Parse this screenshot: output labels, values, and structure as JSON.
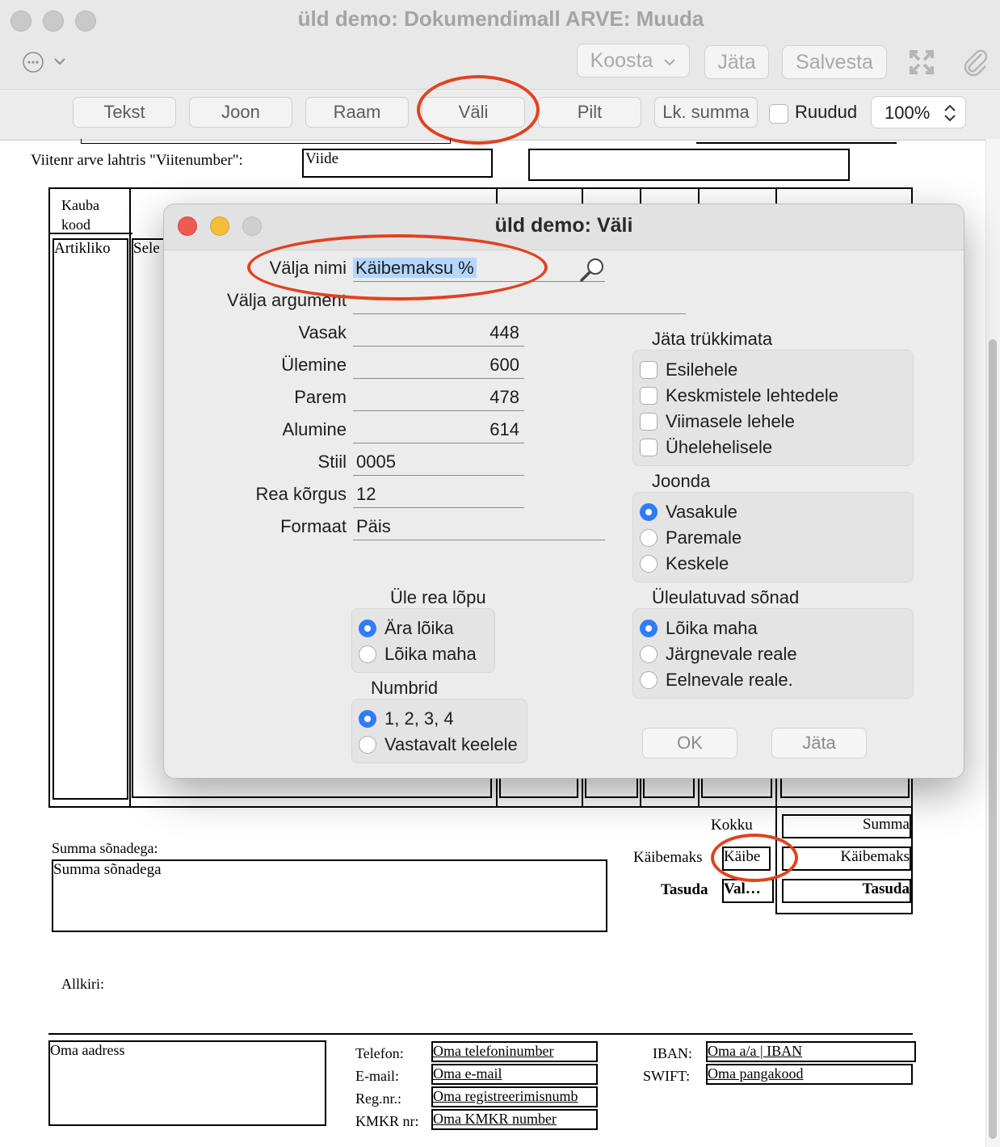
{
  "window": {
    "title": "üld demo: Dokumendimall ARVE: Muuda",
    "buttons": {
      "koosta": "Koosta",
      "jata": "Jäta",
      "salvesta": "Salvesta"
    }
  },
  "toolbar": {
    "tools": [
      "Tekst",
      "Joon",
      "Raam",
      "Väli",
      "Pilt",
      "Lk. summa"
    ],
    "ruudud_label": "Ruudud",
    "zoom": "100%"
  },
  "document": {
    "viitenr_label": "Viitenr arve lahtris \"Viitenumber\":",
    "viide_field": "Viide",
    "kauba_kood": "Kauba\nkood",
    "artikliko": "Artikliko",
    "sele": "Sele",
    "kokku": "Kokku",
    "summa": "Summa",
    "kaibemaks_label": "Käibemaks",
    "kaibe_field": "Käibe",
    "kaibemaks_value": "Käibemaks",
    "tasuda_label": "Tasuda",
    "val_field": "Val…",
    "tasuda_value": "Tasuda",
    "summa_sonadega_label": "Summa sõnadega:",
    "summa_sonadega_field": "Summa sõnadega",
    "allkiri": "Allkiri:",
    "oma_aadress": "Oma aadress",
    "footer_labels": {
      "telefon": "Telefon:",
      "email": "E-mail:",
      "regnr": "Reg.nr.:",
      "kmkr": "KMKR nr:",
      "iban": "IBAN:",
      "swift": "SWIFT:"
    },
    "footer_values": {
      "telefon": "Oma telefoninumber",
      "email": "Oma e-mail",
      "regnr": "Oma registreerimisnumb",
      "kmkr": "Oma KMKR number",
      "iban": "Oma a/a | IBAN",
      "swift": "Oma pangakood"
    }
  },
  "dialog": {
    "title": "üld demo: Väli",
    "fields": {
      "valja_nimi": {
        "label": "Välja nimi",
        "value": "Käibemaksu %"
      },
      "valja_argument": {
        "label": "Välja argument",
        "value": ""
      },
      "vasak": {
        "label": "Vasak",
        "value": "448"
      },
      "ulemine": {
        "label": "Ülemine",
        "value": "600"
      },
      "parem": {
        "label": "Parem",
        "value": "478"
      },
      "alumine": {
        "label": "Alumine",
        "value": "614"
      },
      "stiil": {
        "label": "Stiil",
        "value": "0005"
      },
      "rea_korgus": {
        "label": "Rea kõrgus",
        "value": "12"
      },
      "formaat": {
        "label": "Formaat",
        "value": "Päis"
      }
    },
    "jata_trukkimata": {
      "title": "Jäta trükkimata",
      "options": [
        "Esilehele",
        "Keskmistele lehtedele",
        "Viimasele lehele",
        "Ühelehelisele"
      ]
    },
    "joonda": {
      "title": "Joonda",
      "options": [
        "Vasakule",
        "Paremale",
        "Keskele"
      ],
      "selected": "Vasakule"
    },
    "uleulatuvad": {
      "title": "Üleulatuvad sõnad",
      "options": [
        "Lõika maha",
        "Järgnevale reale",
        "Eelnevale reale."
      ],
      "selected": "Lõika maha"
    },
    "ule_rea_lopu": {
      "title": "Üle rea lõpu",
      "options": [
        "Ära lõika",
        "Lõika maha"
      ],
      "selected": "Ära lõika"
    },
    "numbrid": {
      "title": "Numbrid",
      "options": [
        "1, 2, 3, 4",
        "Vastavalt keelele"
      ],
      "selected": "1, 2, 3, 4"
    },
    "ok": "OK",
    "cancel": "Jäta"
  },
  "colors": {
    "accent": "#2f7cf6",
    "annotation": "#e0421f",
    "selection": "#b3d7ff"
  }
}
